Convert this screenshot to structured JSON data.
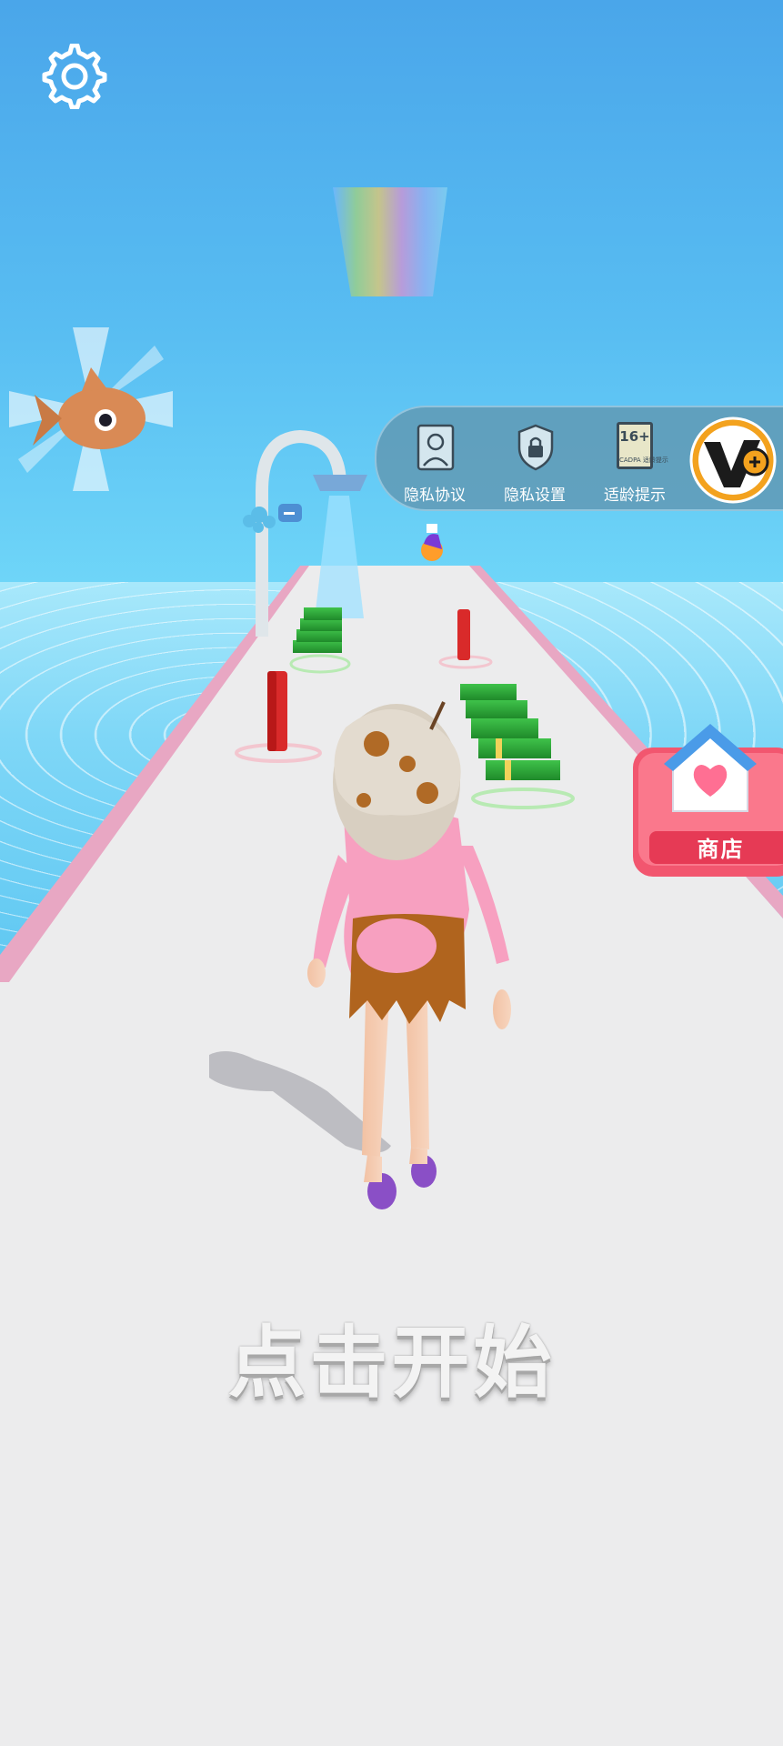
{
  "settings": {
    "icon": "gear-icon"
  },
  "top_menu": {
    "items": [
      {
        "label": "隐私协议",
        "icon": "privacy-agreement-icon"
      },
      {
        "label": "隐私设置",
        "icon": "privacy-settings-lock-icon"
      },
      {
        "label": "适龄提示",
        "icon": "age-rating-icon",
        "age_rating": "16+",
        "age_rating_caption": "CADPA 适龄提示"
      }
    ],
    "logo": "game-logo-icon"
  },
  "shop": {
    "label": "商店",
    "icon": "house-heart-icon"
  },
  "start_prompt": "点击开始",
  "colors": {
    "sky": "#4aa6ea",
    "runway": "#ececec",
    "runway_edge": "#e8a7c3",
    "shop_bg": "#f2566f",
    "menu_bg": "#6097b2"
  }
}
